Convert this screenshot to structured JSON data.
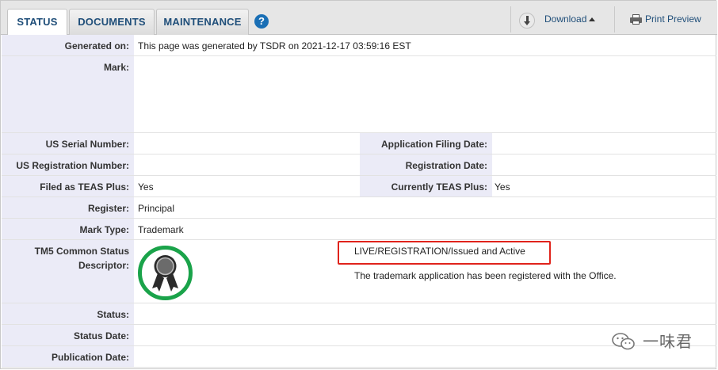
{
  "tabs": [
    {
      "label": "STATUS",
      "active": true
    },
    {
      "label": "DOCUMENTS",
      "active": false
    },
    {
      "label": "MAINTENANCE",
      "active": false
    }
  ],
  "help_icon": "?",
  "toolbar": {
    "download_label": "Download",
    "print_label": "Print Preview"
  },
  "fields": {
    "generated_on": {
      "label": "Generated on:",
      "value": "This page was generated by TSDR on 2021-12-17 03:59:16 EST"
    },
    "mark": {
      "label": "Mark:",
      "value": ""
    },
    "us_serial_number": {
      "label": "US Serial Number:",
      "value": ""
    },
    "application_filing_date": {
      "label": "Application Filing Date:",
      "value": ""
    },
    "us_registration_number": {
      "label": "US Registration Number:",
      "value": ""
    },
    "registration_date": {
      "label": "Registration Date:",
      "value": ""
    },
    "filed_as_teas_plus": {
      "label": "Filed as TEAS Plus:",
      "value": "Yes"
    },
    "currently_teas_plus": {
      "label": "Currently TEAS Plus:",
      "value": "Yes"
    },
    "register": {
      "label": "Register:",
      "value": "Principal"
    },
    "mark_type": {
      "label": "Mark Type:",
      "value": "Trademark"
    },
    "tm5_descriptor": {
      "label_line1": "TM5 Common Status",
      "label_line2": "Descriptor:",
      "status": "LIVE/REGISTRATION/Issued and Active",
      "description": "The trademark application has been registered with the Office."
    },
    "status": {
      "label": "Status:",
      "value": ""
    },
    "status_date": {
      "label": "Status Date:",
      "value": ""
    },
    "publication_date": {
      "label": "Publication Date:",
      "value": ""
    }
  },
  "colors": {
    "tab_text": "#1f4e79",
    "label_bg": "#ebebf7",
    "highlight_border": "#e0231b",
    "badge_ring": "#1aa34a",
    "badge_ribbon": "#2b2b2b"
  },
  "icons": {
    "help": "question-circle-icon",
    "download": "download-arrow-icon",
    "print": "printer-icon",
    "badge": "award-ribbon-icon",
    "watermark": "wechat-icon"
  },
  "watermark": {
    "text": "一味君"
  }
}
